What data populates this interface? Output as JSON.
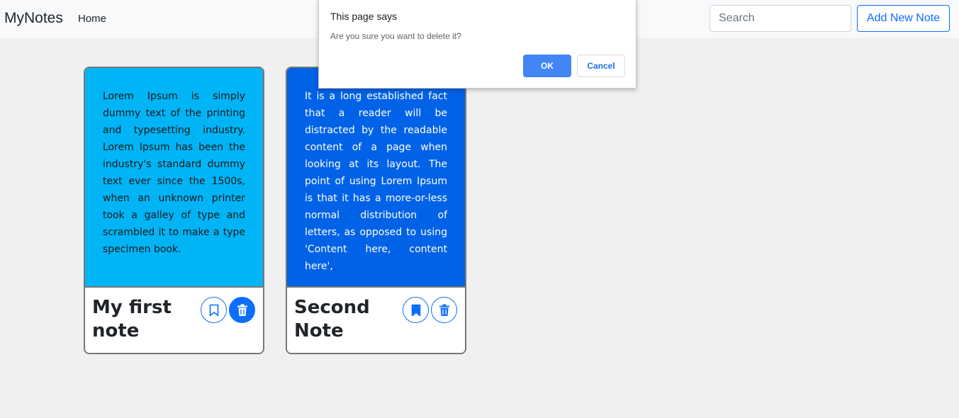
{
  "navbar": {
    "brand": "MyNotes",
    "home": "Home",
    "search_placeholder": "Search",
    "add_note": "Add New Note"
  },
  "notes": [
    {
      "text": "Lorem Ipsum is simply dummy text of the printing and typesetting industry. Lorem Ipsum has been the industry's standard dummy text ever since the 1500s, when an unknown printer took a galley of type and scrambled it to make a type specimen book.",
      "title": "My first note",
      "bookmarked": false,
      "bg_color": "#00b4f5"
    },
    {
      "text": "It is a long established fact that a reader will be distracted by the readable content of a page when looking at its layout. The point of using Lorem Ipsum is that it has a more-or-less normal distribution of letters, as opposed to using 'Content here, content here',",
      "title": "Second Note",
      "bookmarked": true,
      "bg_color": "#0062e6"
    }
  ],
  "dialog": {
    "title": "This page says",
    "message": "Are you sure you want to delete it?",
    "ok": "OK",
    "cancel": "Cancel"
  },
  "colors": {
    "accent": "#0d6efd",
    "page_bg": "#f0f0f0",
    "dialog_ok": "#4285f4"
  },
  "icons": {
    "bookmark": "bookmark-icon",
    "delete": "trash-icon"
  }
}
